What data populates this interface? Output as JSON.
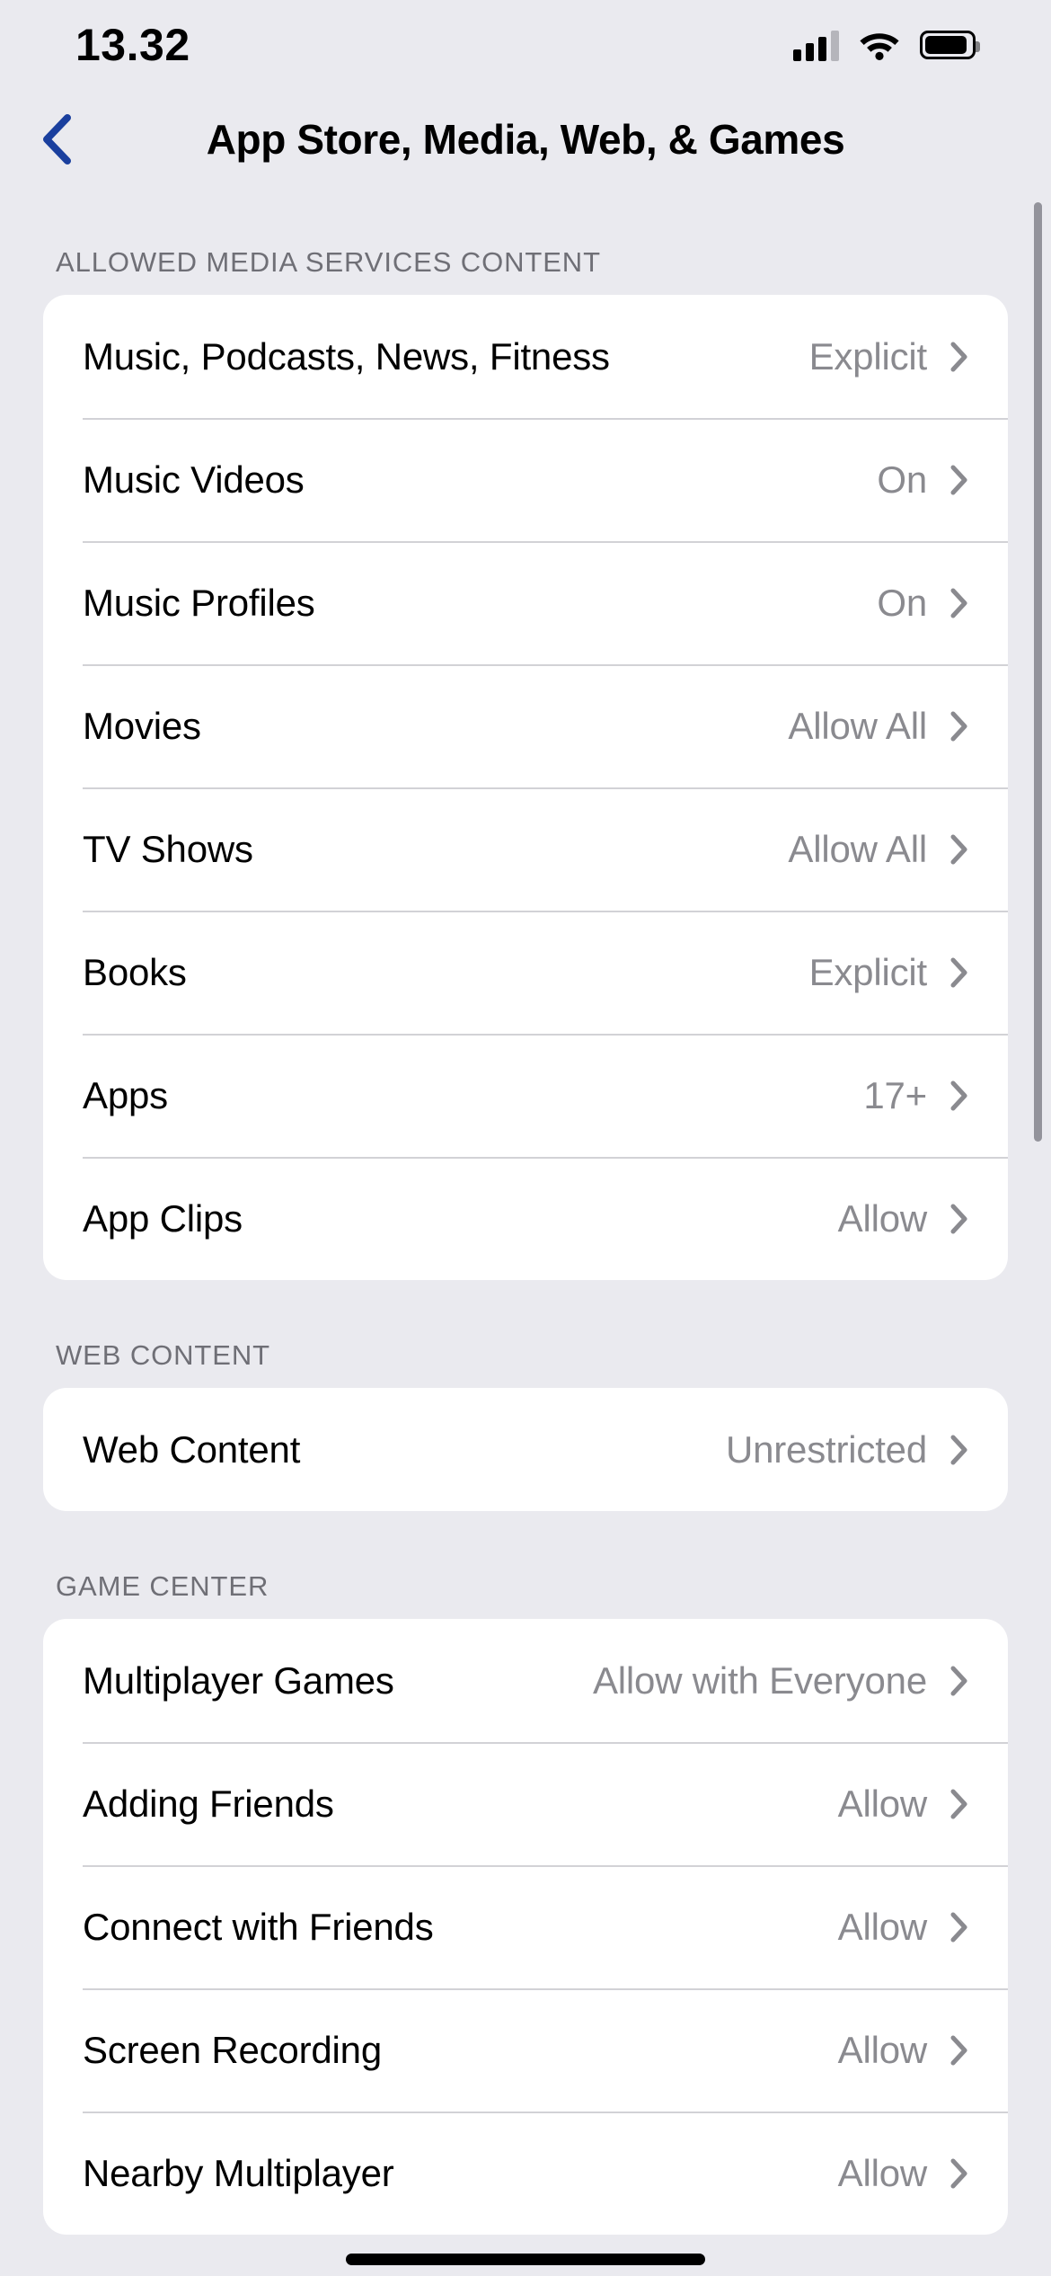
{
  "status_bar": {
    "time": "13.32",
    "cellular_icon": "cellular-signal-icon",
    "cellular_bars_filled": 3,
    "cellular_bars_total": 4,
    "wifi_icon": "wifi-icon",
    "battery_icon": "battery-icon",
    "battery_level_percent": 92
  },
  "nav": {
    "back_icon": "chevron-left-icon",
    "title": "App Store, Media, Web, & Games",
    "accent_color": "#1a3f9e"
  },
  "sections": [
    {
      "header": "ALLOWED MEDIA SERVICES CONTENT",
      "rows": [
        {
          "label": "Music, Podcasts, News, Fitness",
          "value": "Explicit"
        },
        {
          "label": "Music Videos",
          "value": "On"
        },
        {
          "label": "Music Profiles",
          "value": "On"
        },
        {
          "label": "Movies",
          "value": "Allow All"
        },
        {
          "label": "TV Shows",
          "value": "Allow All"
        },
        {
          "label": "Books",
          "value": "Explicit"
        },
        {
          "label": "Apps",
          "value": "17+"
        },
        {
          "label": "App Clips",
          "value": "Allow"
        }
      ]
    },
    {
      "header": "WEB CONTENT",
      "rows": [
        {
          "label": "Web Content",
          "value": "Unrestricted"
        }
      ]
    },
    {
      "header": "GAME CENTER",
      "rows": [
        {
          "label": "Multiplayer Games",
          "value": "Allow with Everyone"
        },
        {
          "label": "Adding Friends",
          "value": "Allow"
        },
        {
          "label": "Connect with Friends",
          "value": "Allow"
        },
        {
          "label": "Screen Recording",
          "value": "Allow"
        },
        {
          "label": "Nearby Multiplayer",
          "value": "Allow"
        }
      ]
    }
  ],
  "colors": {
    "page_background": "#eaeaef",
    "card_background": "#ffffff",
    "primary_text": "#000000",
    "secondary_text": "#8a8a8f",
    "section_header_text": "#6f6f76",
    "separator": "#d2d2d6",
    "chevron": "#8a8a8f",
    "scroll_indicator": "#93939b"
  }
}
